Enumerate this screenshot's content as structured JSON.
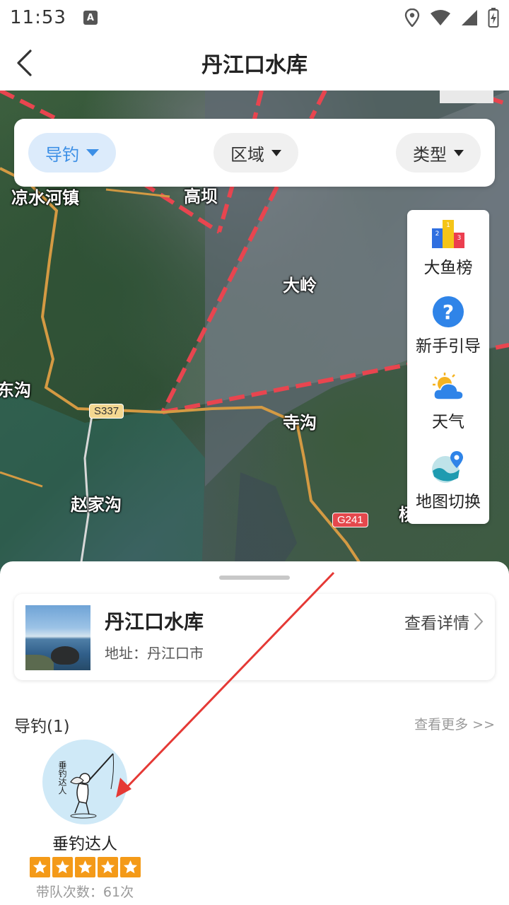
{
  "status_bar": {
    "time": "11:53",
    "notification_icon": "a-icon",
    "icons": [
      "location-icon",
      "wifi-icon",
      "signal-icon",
      "battery-charging-icon"
    ]
  },
  "app_bar": {
    "title": "丹江口水库",
    "back_icon": "chevron-left-icon"
  },
  "filters": [
    {
      "label": "导钓",
      "active": true
    },
    {
      "label": "区域",
      "active": false
    },
    {
      "label": "类型",
      "active": false
    }
  ],
  "map": {
    "labels": [
      "凉水河镇",
      "高坝",
      "大岭",
      "东沟",
      "寺沟",
      "赵家沟",
      "杨"
    ],
    "roads": [
      "S337",
      "G241"
    ]
  },
  "side_tools": [
    {
      "label": "大鱼榜",
      "icon": "podium-icon"
    },
    {
      "label": "新手引导",
      "icon": "help-icon"
    },
    {
      "label": "天气",
      "icon": "weather-icon"
    },
    {
      "label": "地图切换",
      "icon": "map-switch-icon"
    }
  ],
  "spot": {
    "name": "丹江口水库",
    "address": "地址：丹江口市",
    "detail_link": "查看详情"
  },
  "guides": {
    "header": "导钓(1)",
    "more": "查看更多 >>",
    "items": [
      {
        "name": "垂钓达人",
        "stars": 5,
        "count_text": "带队次数：61次",
        "avatar_text": "垂钓达人"
      }
    ]
  },
  "colors": {
    "accent": "#3c8fe6",
    "star": "#f49a18",
    "annotation_arrow": "#e53935",
    "zone_dash": "#e8454f"
  }
}
